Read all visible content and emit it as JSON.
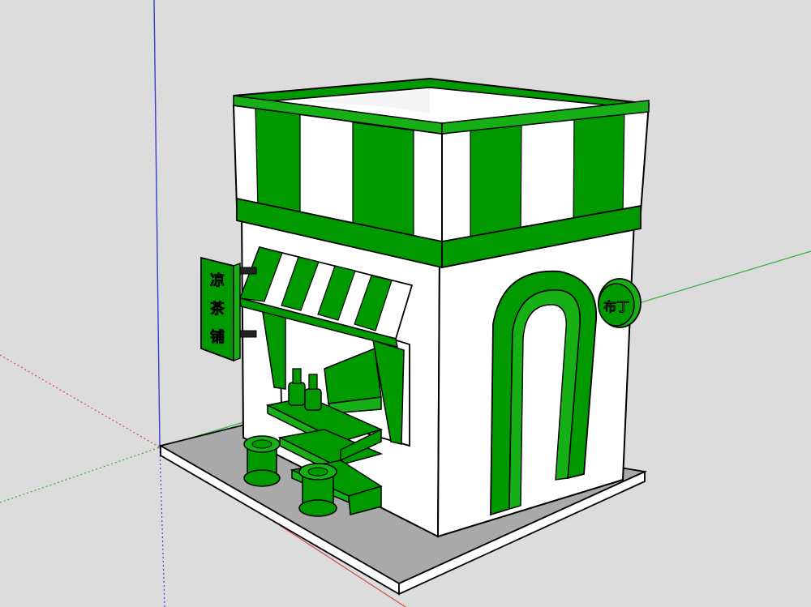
{
  "app": {
    "type": "3d-modeling-viewport"
  },
  "colors": {
    "background": "#dcdcdc",
    "primary_green": "#009a00",
    "green_light": "#16b016",
    "white": "#ffffff",
    "outline": "#000000",
    "base_plate": "#a9a9a9",
    "axis_red": "#d24b4b",
    "axis_green": "#3aaa3a",
    "axis_blue": "#3b3bd0"
  },
  "scene": {
    "axes": {
      "red_axis": "red",
      "green_axis": "green",
      "blue_axis": "blue"
    },
    "model": {
      "hanging_sign_text": [
        "凉",
        "茶",
        "铺"
      ],
      "round_sign_text": "布丁",
      "awning_pattern": "green-white-stripes",
      "roof_pattern": "green-white-stripes"
    }
  }
}
